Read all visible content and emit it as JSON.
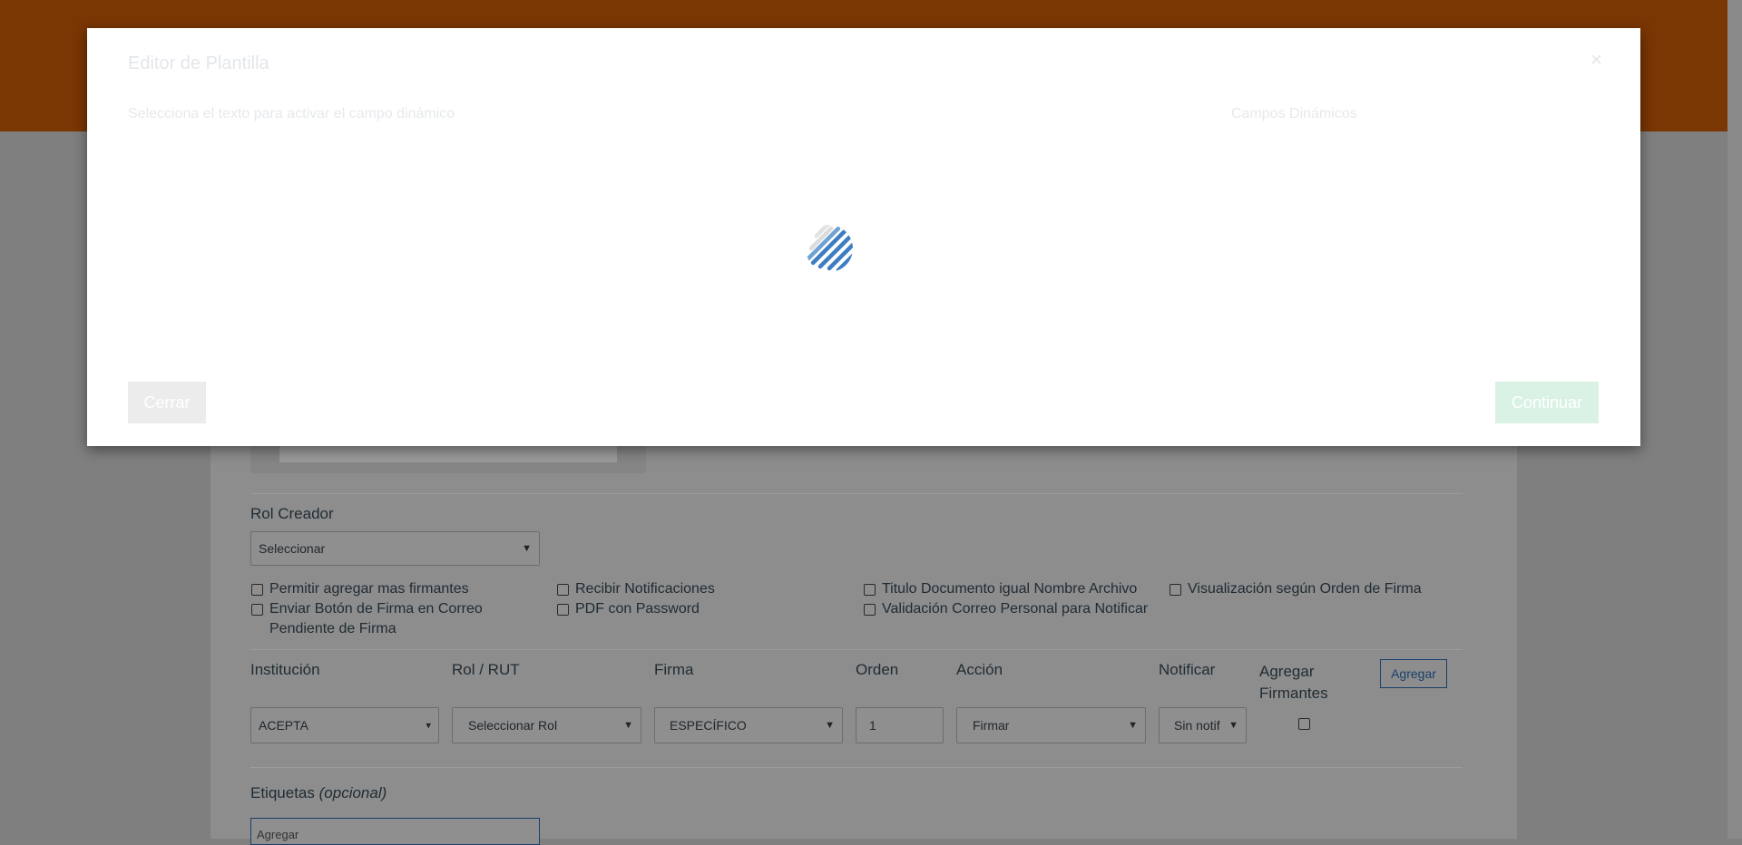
{
  "modal": {
    "title": "Editor de Plantilla",
    "close_glyph": "×",
    "subtitle": "Selecciona el texto para activar el campo dinámico",
    "dynamic_fields_label": "Campos Dinámicos",
    "cancel_label": "Cerrar",
    "continue_label": "Continuar",
    "spinner_icon": "loading-spinner-icon"
  },
  "form": {
    "rol_creador_label": "Rol Creador",
    "rol_creador_value": "Seleccionar",
    "checkboxes": [
      {
        "label": "Permitir agregar mas firmantes",
        "checked": false
      },
      {
        "label": "Recibir Notificaciones",
        "checked": false
      },
      {
        "label": "Titulo Documento igual Nombre Archivo",
        "checked": false
      },
      {
        "label": "Visualización según Orden de Firma",
        "checked": false
      },
      {
        "label": "Enviar Botón de Firma en Correo Pendiente de Firma",
        "checked": false
      },
      {
        "label": "PDF con Password",
        "checked": false
      },
      {
        "label": "Validación Correo Personal para Notificar",
        "checked": false
      }
    ],
    "columns": {
      "institucion": "Institución",
      "rol_rut": "Rol / RUT",
      "firma": "Firma",
      "orden": "Orden",
      "accion": "Acción",
      "notificar": "Notificar",
      "agregar_firmantes": "Agregar Firmantes"
    },
    "add_button_label": "Agregar",
    "row": {
      "institucion": "ACEPTA",
      "rol": "Seleccionar Rol",
      "firma": "ESPECÍFICO",
      "orden": "1",
      "accion": "Firmar",
      "notificar": "Sin notif",
      "agregar_firmantes_checked": false
    },
    "etiquetas_label": "Etiquetas",
    "etiquetas_optional": "(opcional)",
    "etiquetas_placeholder": "Agregar"
  },
  "colors": {
    "header": "#7a3603",
    "overlay": "#808080",
    "accent_blue": "#1a3f6b",
    "spinner": "#3d7ec2"
  }
}
